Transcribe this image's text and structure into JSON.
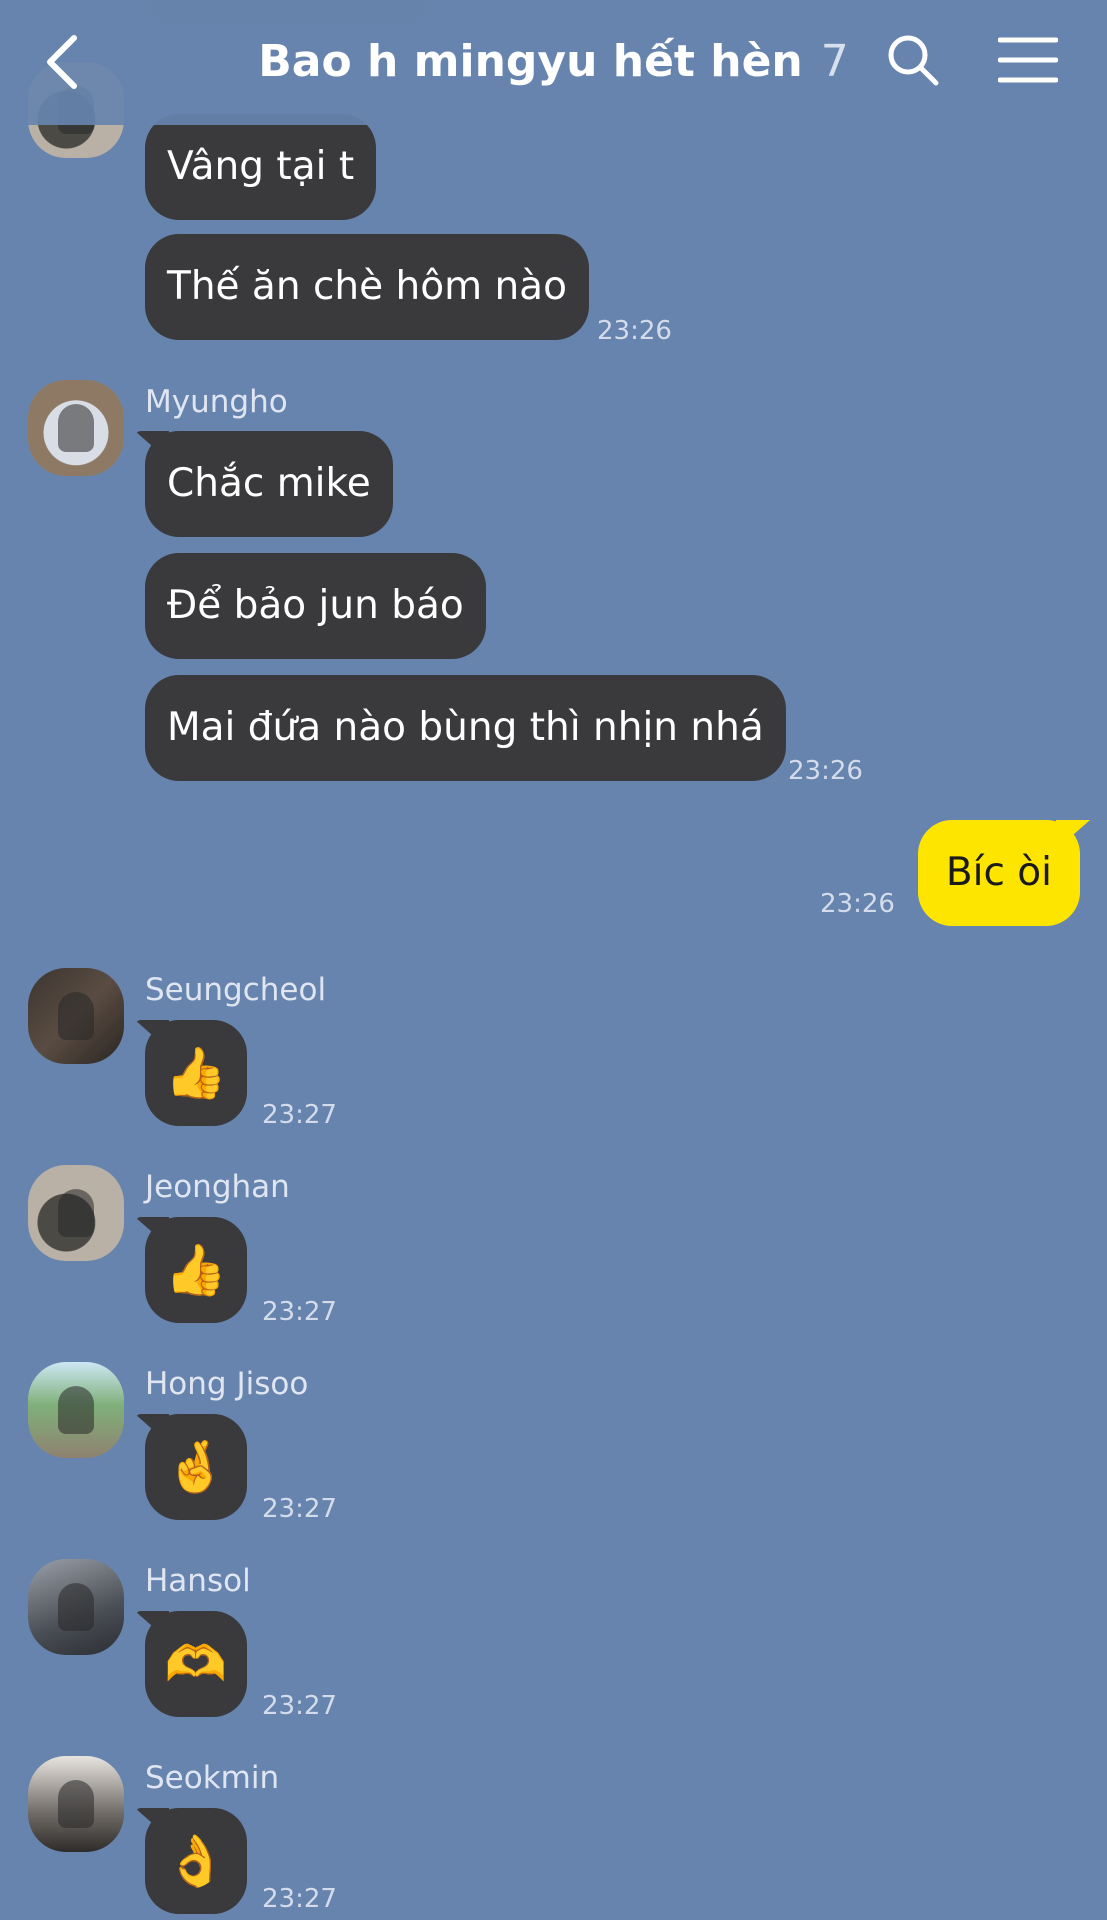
{
  "header": {
    "title": "Bao h mingyu hết hèn",
    "member_count": "7"
  },
  "messages": {
    "m1": "Vâng tại t",
    "m2": "Thế ăn chè hôm nào",
    "m2_time": "23:26",
    "myungho_name": "Myungho",
    "m3": "Chắc mike",
    "m4": "Để bảo jun báo",
    "m5": "Mai đứa nào bùng thì nhịn nhá",
    "m5_time": "23:26",
    "mine": "Bíc òi",
    "mine_time": "23:26",
    "seung_name": "Seungcheol",
    "seung_emoji": "👍",
    "seung_time": "23:27",
    "jeong_name": "Jeonghan",
    "jeong_emoji": "👍",
    "jeong_time": "23:27",
    "hong_name": "Hong Jisoo",
    "hong_emoji": "🤞",
    "hong_time": "23:27",
    "hansol_name": "Hansol",
    "hansol_emoji": "🫶",
    "hansol_time": "23:27",
    "seok_name": "Seokmin",
    "seok_emoji": "👌",
    "seok_time": "23:27"
  },
  "colors": {
    "background": "#6784ae",
    "bubble_other": "#3a3a3c",
    "bubble_mine": "#fee500"
  },
  "icons": {
    "back": "back-icon",
    "search": "search-icon",
    "menu": "menu-icon"
  }
}
